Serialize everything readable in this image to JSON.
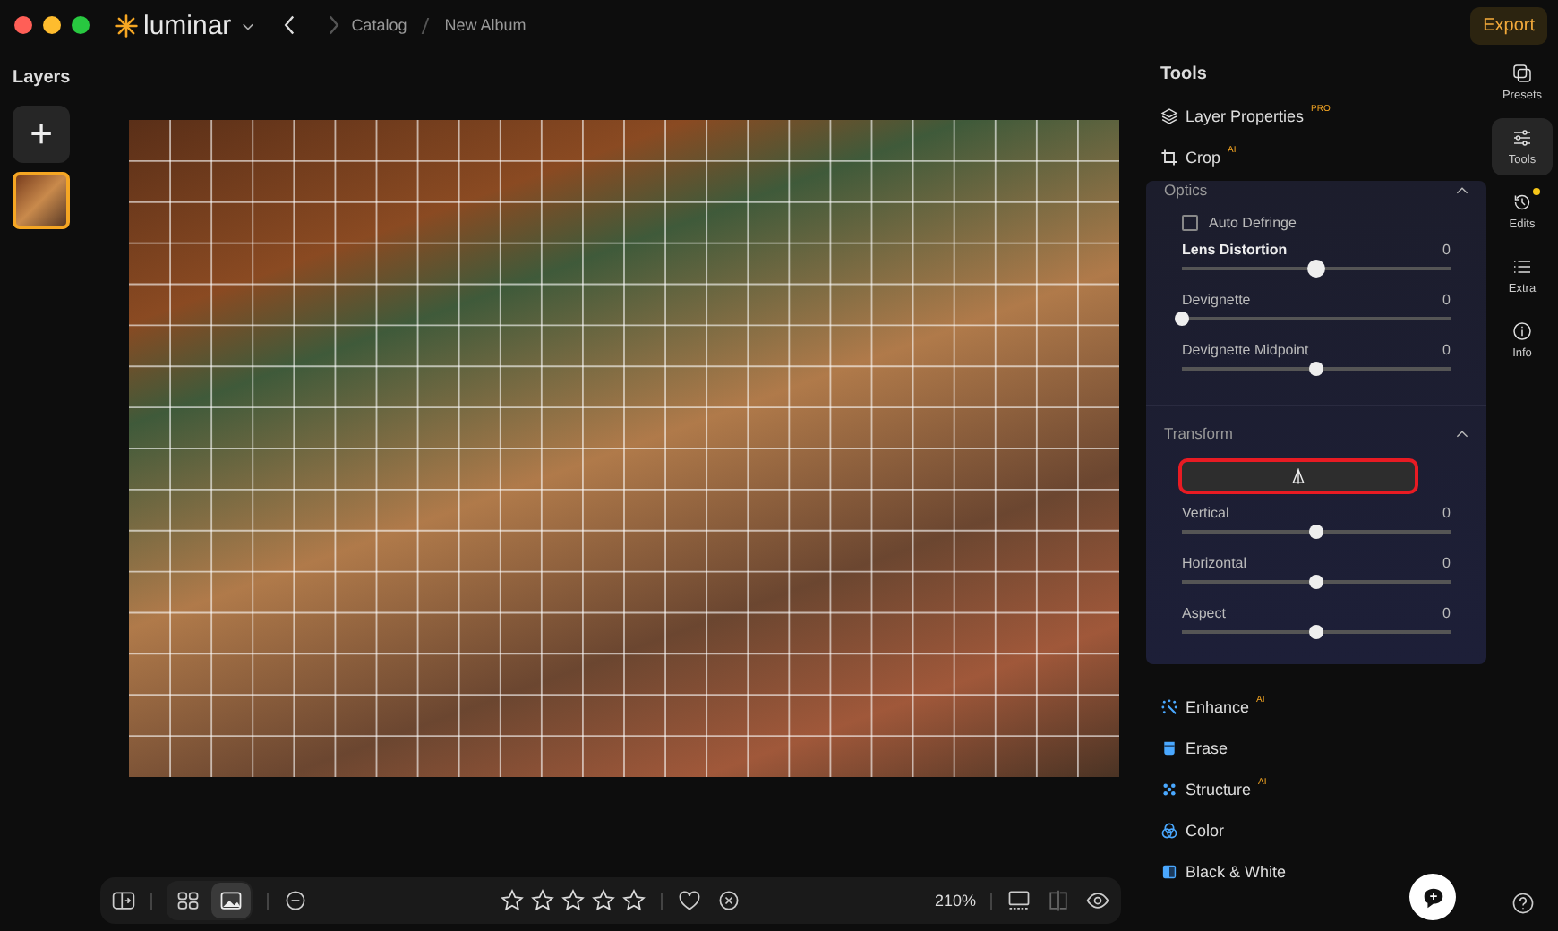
{
  "window": {
    "app_name": "luminar",
    "breadcrumb": [
      "Catalog",
      "New Album"
    ],
    "export_label": "Export"
  },
  "layers": {
    "title": "Layers",
    "add_label": "+",
    "thumbnails": [
      {
        "selected": true
      }
    ]
  },
  "tools": {
    "title": "Tools",
    "top_items": [
      {
        "label": "Layer Properties",
        "badge": "PRO"
      },
      {
        "label": "Crop",
        "badge": "AI"
      }
    ],
    "optics": {
      "title": "Optics",
      "expanded": true,
      "checkbox": {
        "label": "Auto Defringe",
        "checked": false
      },
      "sliders": [
        {
          "label": "Lens Distortion",
          "value": "0",
          "level": 0.5,
          "bold": true
        },
        {
          "label": "Devignette",
          "value": "0",
          "level": 0,
          "bold": false
        },
        {
          "label": "Devignette Midpoint",
          "value": "0",
          "level": 0.5,
          "bold": false
        }
      ]
    },
    "transform": {
      "title": "Transform",
      "expanded": true,
      "sliders": [
        {
          "label": "Vertical",
          "value": "0",
          "level": 0.5
        },
        {
          "label": "Horizontal",
          "value": "0",
          "level": 0.5
        },
        {
          "label": "Aspect",
          "value": "0",
          "level": 0.5
        }
      ]
    },
    "bottom_items": [
      {
        "label": "Enhance",
        "badge": "AI"
      },
      {
        "label": "Erase"
      },
      {
        "label": "Structure",
        "badge": "AI"
      },
      {
        "label": "Color"
      },
      {
        "label": "Black & White"
      }
    ]
  },
  "rail": [
    {
      "label": "Presets",
      "selected": false,
      "dot": false
    },
    {
      "label": "Tools",
      "selected": true,
      "dot": false
    },
    {
      "label": "Edits",
      "selected": false,
      "dot": true
    },
    {
      "label": "Extra",
      "selected": false,
      "dot": false
    },
    {
      "label": "Info",
      "selected": false,
      "dot": false
    }
  ],
  "bottom_bar": {
    "view_modes": [
      {
        "selected": false
      },
      {
        "selected": true
      }
    ],
    "stars": 0,
    "zoom": "210%"
  }
}
